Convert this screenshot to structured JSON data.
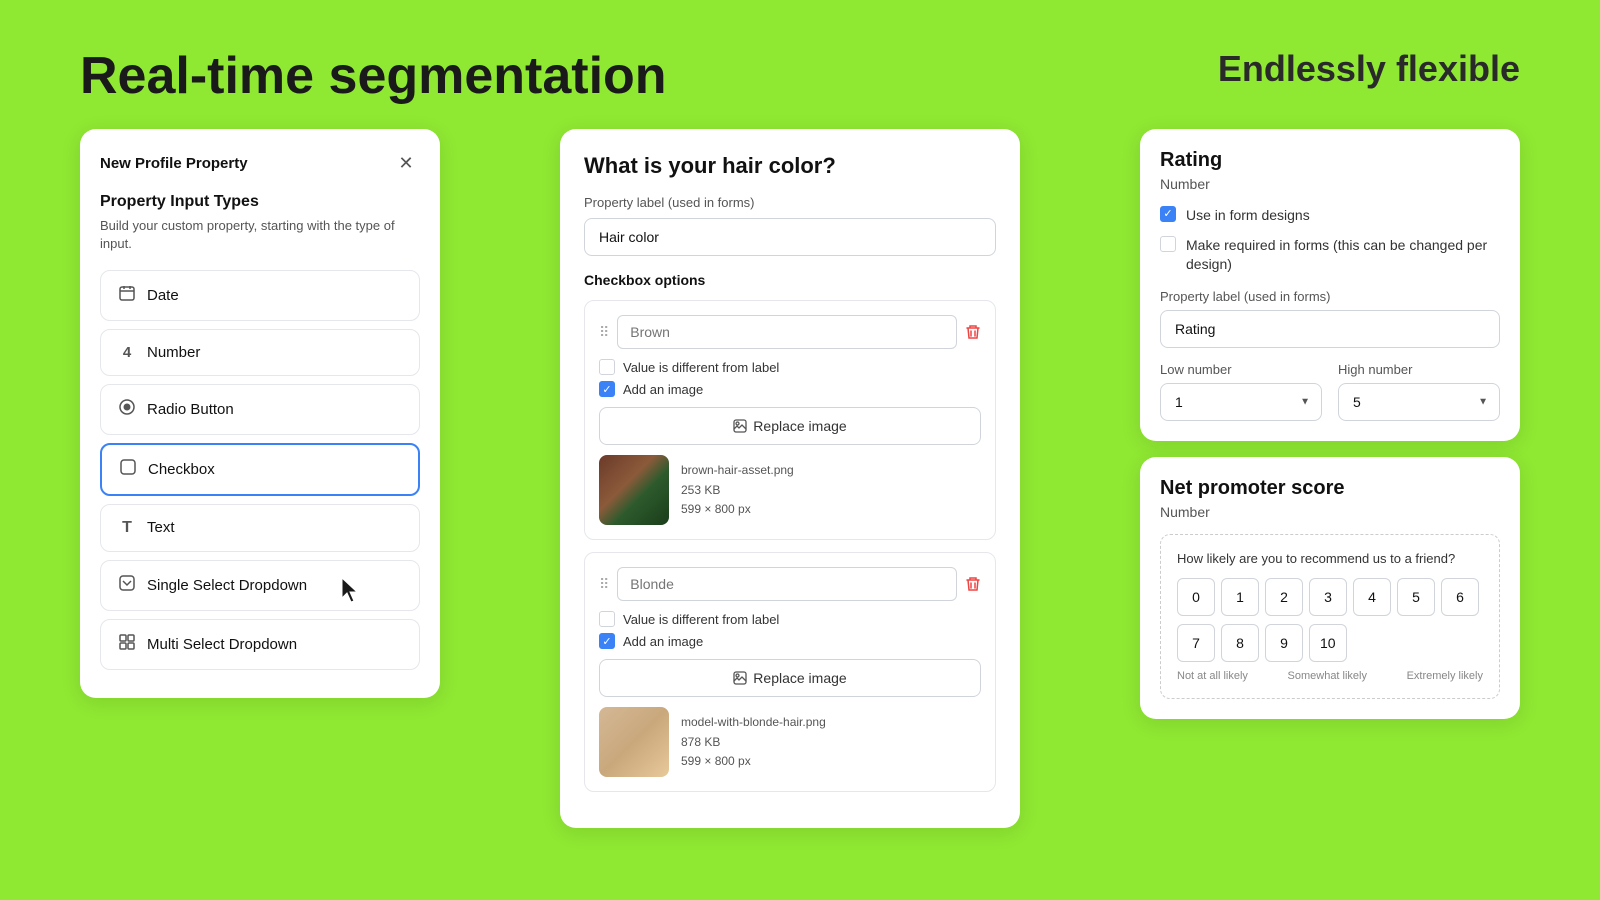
{
  "header": {
    "title": "Real-time segmentation",
    "subtitle": "Endlessly flexible"
  },
  "left_panel": {
    "title": "New Profile Property",
    "section_title": "Property Input Types",
    "description": "Build your custom property, starting with the type of input.",
    "items": [
      {
        "id": "date",
        "label": "Date",
        "icon": "📅"
      },
      {
        "id": "number",
        "label": "Number",
        "icon": "4"
      },
      {
        "id": "radio",
        "label": "Radio Button",
        "icon": "◎"
      },
      {
        "id": "checkbox",
        "label": "Checkbox",
        "icon": "☐",
        "active": true
      },
      {
        "id": "text",
        "label": "Text",
        "icon": "T"
      },
      {
        "id": "single-select",
        "label": "Single Select Dropdown",
        "icon": "▼"
      },
      {
        "id": "multi-select",
        "label": "Multi Select Dropdown",
        "icon": "⊞"
      }
    ]
  },
  "middle_panel": {
    "heading": "What is your hair color?",
    "property_label_text": "Property label (used in forms)",
    "property_label_value": "Hair color",
    "checkbox_options_label": "Checkbox options",
    "options": [
      {
        "placeholder": "Brown",
        "value_diff_label": "Value is different from label",
        "value_diff_checked": false,
        "add_image_label": "Add an image",
        "add_image_checked": true,
        "replace_image_label": "Replace image",
        "image_filename": "brown-hair-asset.png",
        "image_size": "253 KB",
        "image_dimensions": "599 × 800 px"
      },
      {
        "placeholder": "Blonde",
        "value_diff_label": "Value is different from label",
        "value_diff_checked": false,
        "add_image_label": "Add an image",
        "add_image_checked": true,
        "replace_image_label": "Replace image",
        "image_filename": "model-with-blonde-hair.png",
        "image_size": "878 KB",
        "image_dimensions": "599 × 800 px"
      }
    ]
  },
  "right_rating_card": {
    "title": "Rating",
    "subtitle": "Number",
    "checkbox1_label": "Use in form designs",
    "checkbox1_checked": true,
    "checkbox2_label": "Make required in forms (this can be changed per design)",
    "checkbox2_checked": false,
    "prop_label_title": "Property label (used in forms)",
    "prop_label_value": "Rating",
    "low_number_label": "Low number",
    "low_number_value": "1",
    "high_number_label": "High number",
    "high_number_value": "5"
  },
  "right_nps_card": {
    "title": "Net promoter score",
    "subtitle": "Number",
    "question": "How likely are you to recommend us to a friend?",
    "numbers_row1": [
      "0",
      "1",
      "2",
      "3",
      "4",
      "5",
      "6"
    ],
    "numbers_row2": [
      "7",
      "8",
      "9",
      "10"
    ],
    "label_left": "Not at all likely",
    "label_middle": "Somewhat likely",
    "label_right": "Extremely likely"
  }
}
